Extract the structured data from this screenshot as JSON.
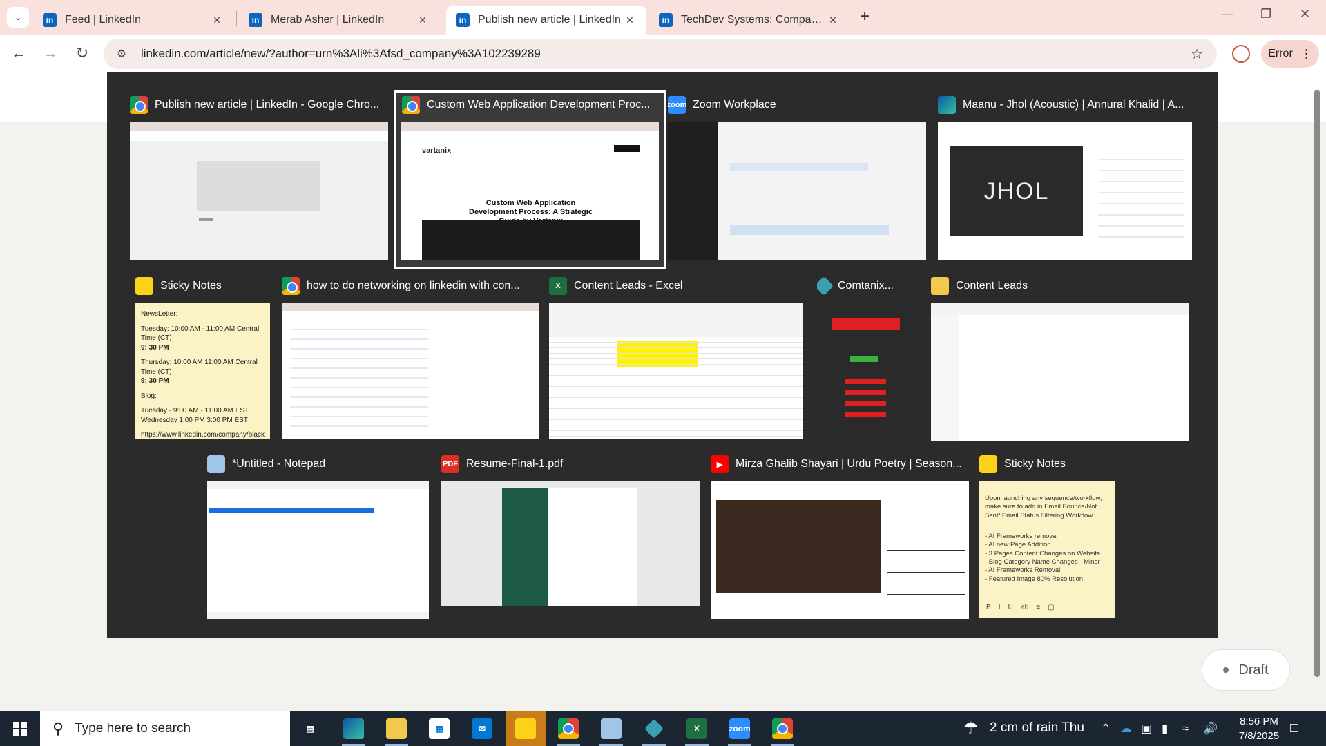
{
  "browser": {
    "tabs": [
      {
        "label": "Feed | LinkedIn",
        "active": false
      },
      {
        "label": "Merab Asher | LinkedIn",
        "active": false
      },
      {
        "label": "Publish new article | LinkedIn",
        "active": true
      },
      {
        "label": "TechDev Systems: Company Pa",
        "active": false
      }
    ],
    "url": "linkedin.com/article/new/?author=urn%3Ali%3Afsd_company%3A102239289",
    "error_label": "Error"
  },
  "page": {
    "draft_label": "Draft"
  },
  "switcher": {
    "windows": [
      {
        "title": "Publish new article | LinkedIn - Google Chro...",
        "icon": "chrome-icon",
        "thumb_color": "#f1f1f1"
      },
      {
        "title": "Custom Web Application Development Proc...",
        "icon": "chrome-icon",
        "thumb_color": "#ffffff",
        "selected": true,
        "thumb_headline": "Custom Web Application Development Process: A Strategic Guide by Vartanix",
        "thumb_brand": "vartanix"
      },
      {
        "title": "Zoom Workplace",
        "icon": "zoom-icon",
        "thumb_color": "#1f1f1f"
      },
      {
        "title": "Maanu - Jhol (Acoustic) | Annural Khalid | A...",
        "icon": "edge-icon",
        "thumb_color": "#ffffff",
        "thumb_video_text": "JHOL"
      },
      {
        "title": "Sticky Notes",
        "icon": "sticky-notes-icon",
        "thumb_color": "#fbf2c5"
      },
      {
        "title": "how to do networking on linkedin with con...",
        "icon": "chrome-icon",
        "thumb_color": "#ffffff"
      },
      {
        "title": "Content Leads - Excel",
        "icon": "excel-icon",
        "thumb_color": "#ffffff"
      },
      {
        "title": "Comtanix...",
        "icon": "comtanix-icon",
        "thumb_color": "#2a2a2a"
      },
      {
        "title": "Content Leads",
        "icon": "folder-icon",
        "thumb_color": "#ffffff"
      },
      {
        "title": "*Untitled - Notepad",
        "icon": "notepad-icon",
        "thumb_color": "#ffffff"
      },
      {
        "title": "Resume-Final-1.pdf",
        "icon": "pdf-icon",
        "thumb_color": "#e8e8e8"
      },
      {
        "title": "Mirza Ghalib Shayari | Urdu Poetry | Season...",
        "icon": "youtube-icon",
        "thumb_color": "#ffffff"
      },
      {
        "title": "Sticky Notes",
        "icon": "sticky-notes-icon",
        "thumb_color": "#fbf2c5"
      }
    ],
    "sticky1": {
      "heading": "NewsLetter:",
      "line1": "Tuesday: 10:00 AM - 11:00 AM Central Time (CT)",
      "time1": "9: 30 PM",
      "line2": "Thursday: 10:00 AM   11:00 AM Central Time (CT)",
      "time2": "9: 30 PM",
      "blog_heading": "Blog:",
      "blog1": "Tuesday - 9:00 AM - 11:00 AM EST",
      "blog2": "Wednesday   1:00 PM   3:00 PM EST",
      "link": "https://www.linkedin.com/company/black"
    },
    "sticky2": {
      "intro": "Upon launching any sequence/workflow, make sure to add in Email Bounce/Not Sent/ Email Status Filtering Workflow",
      "items": [
        "- AI Frameworks removal",
        "- AI new Page Addition",
        "- 3 Pages Content Changes on Website",
        "- Blog Category Name Changes - Minor",
        "- AI Frameworks Removal",
        "- Featured Image 80% Resolution"
      ]
    }
  },
  "taskbar": {
    "search_placeholder": "Type here to search",
    "weather": "2 cm of rain Thu",
    "time": "8:56 PM",
    "date": "7/8/2025"
  }
}
